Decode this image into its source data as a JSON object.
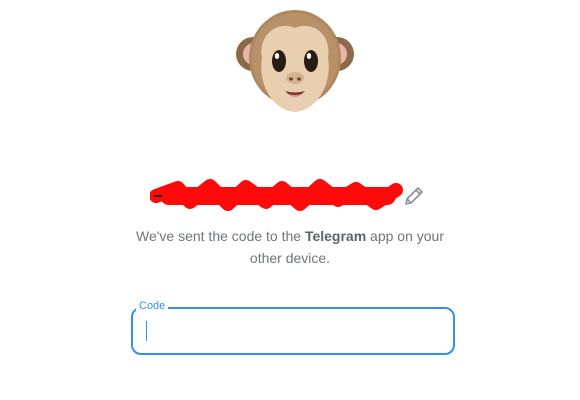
{
  "auth": {
    "phone_number_redacted": "",
    "message_part1": "We've sent the code to the ",
    "message_app": "Telegram",
    "message_part2": " app on your other device.",
    "code_field": {
      "label": "Code",
      "value": ""
    }
  },
  "colors": {
    "accent": "#3390ec",
    "text_secondary": "#707579",
    "redaction": "#ff0000"
  },
  "icons": {
    "avatar": "monkey-face",
    "edit": "pencil-icon"
  }
}
